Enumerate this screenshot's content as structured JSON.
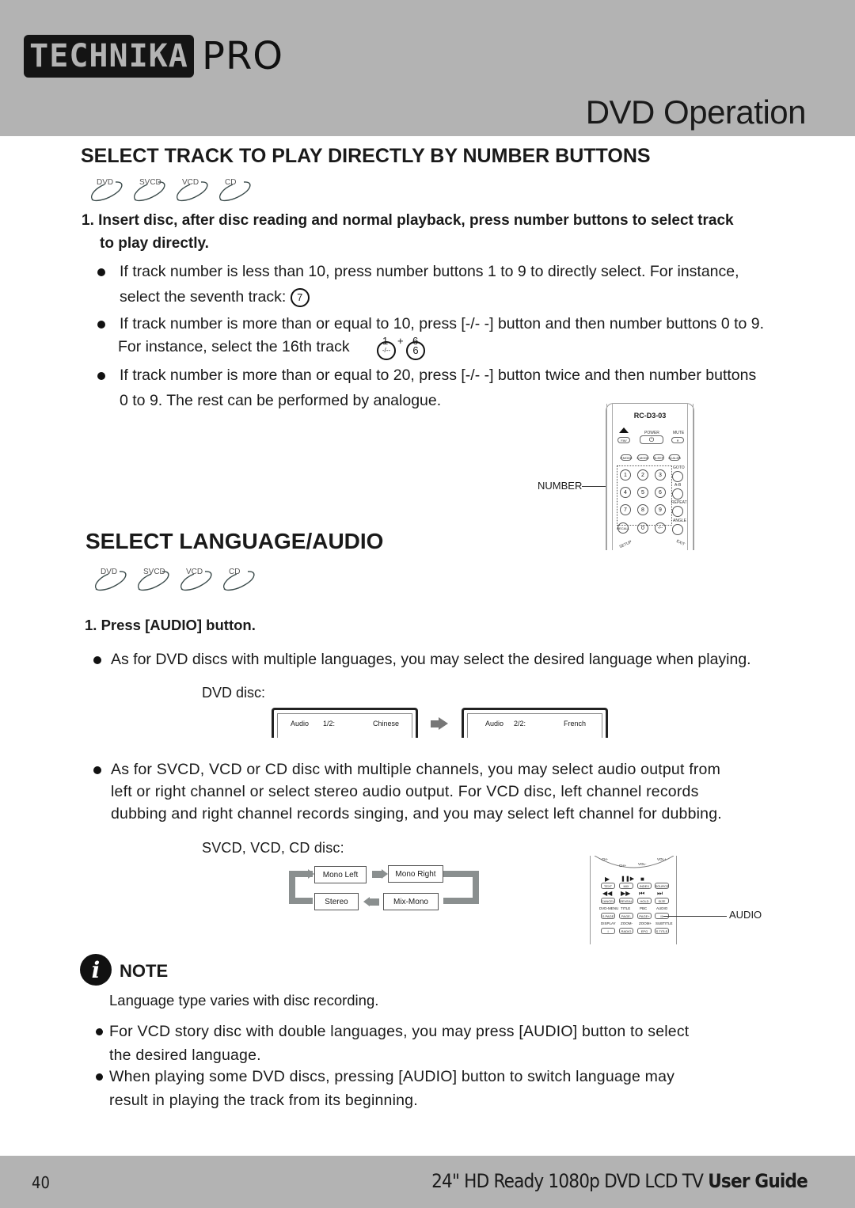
{
  "header": {
    "brand_logo": "TECHNIKA",
    "brand_suffix": "PRO",
    "section": "DVD Operation"
  },
  "track_section": {
    "title": "SELECT TRACK TO PLAY DIRECTLY BY NUMBER BUTTONS",
    "disc_types": [
      "DVD",
      "SVCD",
      "VCD",
      "CD"
    ],
    "step1_line1": "1. Insert disc, after disc reading and normal playback, press number buttons to select track",
    "step1_line2": "to play directly.",
    "bullets": [
      {
        "line1": "If track number is less than 10, press number buttons 1 to 9 to directly select. For instance,",
        "line2": "select the seventh track:",
        "button": "7"
      },
      {
        "line1": "If track number is more than or equal to 10, press [-/- -] button and then number buttons 0 to 9.",
        "line2": "For instance, select the 16th track",
        "sup1": "1",
        "sup_plus": "+",
        "sup2": "6",
        "button1": "-/--",
        "button2": "6"
      },
      {
        "line1": "If track number is more than or equal to 20, press [-/- -] button twice and then number buttons",
        "line2": "0 to 9. The rest can be performed by analogue."
      }
    ],
    "remote": {
      "model": "RC-D3-03",
      "callout": "NUMBER",
      "labels": {
        "power": "POWER",
        "mute": "MUTE",
        "fav": "FAV",
        "pmode": "P.MODE",
        "smode": "S.MODE",
        "sleep": "SLEEP",
        "scaler": "SCALER",
        "goto": "GOTO",
        "ab": "A-B",
        "repeat": "REPEAT",
        "angle": "ANGLE",
        "recall": "RECALL",
        "dash": "-/--",
        "setup": "SETUP",
        "exit": "EXIT"
      },
      "numbers": [
        "1",
        "2",
        "3",
        "4",
        "5",
        "6",
        "7",
        "8",
        "9",
        "0"
      ]
    }
  },
  "audio_section": {
    "title": "SELECT LANGUAGE/AUDIO",
    "disc_types": [
      "DVD",
      "SVCD",
      "VCD",
      "CD"
    ],
    "step1": "1. Press [AUDIO] button.",
    "bullet1": "As for DVD  discs with multiple languages, you may select the desired language when playing.",
    "dvd_label": "DVD disc:",
    "osd": [
      {
        "label": "Audio",
        "index": "1/2:",
        "language": "Chinese"
      },
      {
        "label": "Audio",
        "index": "2/2:",
        "language": "French"
      }
    ],
    "bullet2_lines": [
      "As for SVCD, VCD or CD disc with multiple channels, you may select audio output from",
      "left or right channel or select stereo audio output. For VCD disc, left channel records",
      "dubbing and right channel records singing, and you may select left channel for dubbing."
    ],
    "svcd_label": "SVCD, VCD, CD disc:",
    "flow": {
      "mono_left": "Mono Left",
      "mono_right": "Mono Right",
      "stereo": "Stereo",
      "mix_mono": "Mix-Mono"
    },
    "remote2": {
      "callout": "AUDIO",
      "top_labels": [
        "CH-",
        "CH+",
        "VOL-",
        "VOL+"
      ],
      "rows": [
        [
          "TEXT",
          "MIX",
          "INDEX",
          "SOURCE"
        ],
        [
          "CANCEL",
          "REVEAL",
          "HOLD",
          "SIZE"
        ],
        [
          "S.PAGE",
          "PAGE-",
          "PAGE+",
          "III"
        ],
        [
          "I",
          "RADIO",
          "EPG",
          "S.TITLE"
        ]
      ],
      "row_labels": [
        [
          "DVD-MENU",
          "TITLE",
          "PBC",
          "AUDIO"
        ],
        [
          "DISPLAY",
          "ZOOM-",
          "ZOOM+",
          "SUBTITLE"
        ]
      ]
    }
  },
  "note": {
    "title": "NOTE",
    "text": "Language type varies with disc recording.",
    "bullets": [
      {
        "line1": "For VCD story disc with double languages, you may press [AUDIO] button to select",
        "line2": "the desired language."
      },
      {
        "line1": "When playing some DVD discs, pressing [AUDIO] button to switch language may",
        "line2": "result in playing the track from its beginning."
      }
    ]
  },
  "footer": {
    "page_number": "40",
    "product": "24\" HD Ready 1080p DVD LCD TV",
    "guide": "User Guide"
  }
}
